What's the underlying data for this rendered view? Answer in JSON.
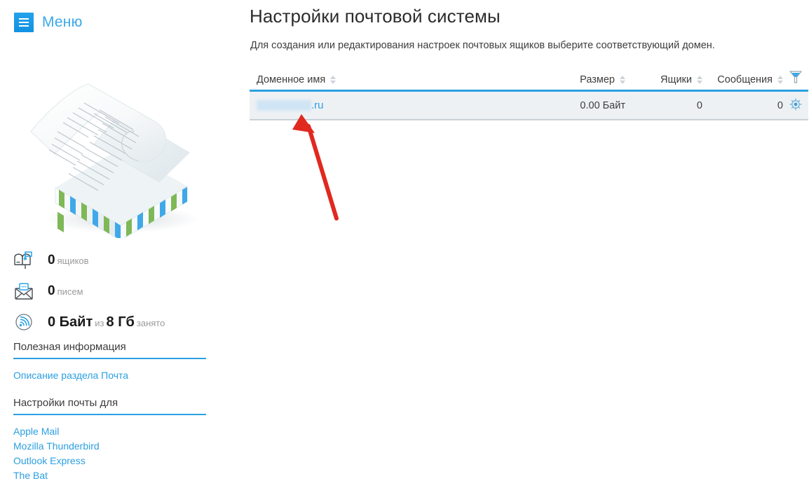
{
  "sidebar": {
    "menu": {
      "label": "Меню",
      "icon": "hamburger-icon"
    },
    "illustration_icon": "envelope-with-letter-illustration",
    "stats": [
      {
        "icon": "mailbox-icon",
        "value": "0",
        "unit": "ящиков",
        "suffix": "",
        "suffix2": ""
      },
      {
        "icon": "envelope-icon",
        "value": "0",
        "unit": "писем",
        "suffix": "",
        "suffix2": ""
      },
      {
        "icon": "signal-icon",
        "value": "0 Байт",
        "mid": "из",
        "value2": "8 Гб",
        "unit": "занято"
      }
    ],
    "sections": [
      {
        "title": "Полезная информация",
        "links": [
          "Описание раздела Почта"
        ]
      },
      {
        "title": "Настройки почты для",
        "links": [
          "Apple Mail",
          "Mozilla Thunderbird",
          "Outlook Express",
          "The Bat"
        ]
      }
    ]
  },
  "main": {
    "title": "Настройки почтовой системы",
    "subtitle": "Для создания или редактирования настроек почтовых ящиков выберите соответствующий домен.",
    "table": {
      "columns": [
        {
          "label": "Доменное имя",
          "sortable": true
        },
        {
          "label": "Размер",
          "sortable": true
        },
        {
          "label": "Ящики",
          "sortable": true
        },
        {
          "label": "Сообщения",
          "sortable": true
        },
        {
          "label": "",
          "icon": "filter-funnel-icon"
        }
      ],
      "rows": [
        {
          "domain_redacted": true,
          "domain_suffix": ".ru",
          "size": "0.00 Байт",
          "boxes": "0",
          "messages": "0",
          "action_icon": "gear-icon"
        }
      ]
    }
  },
  "annotation": {
    "arrow_icon": "red-arrow-pointing-up-left",
    "color": "#e0291f"
  },
  "colors": {
    "accent_blue": "#2ca0e2",
    "link_blue": "#2b9fe0",
    "menu_blue": "#1b9ae8",
    "row_bg": "#eef1f4",
    "row_border": "#c9d2d8",
    "sorter_gray": "#ccd4da",
    "annotation_red": "#e0291f"
  }
}
